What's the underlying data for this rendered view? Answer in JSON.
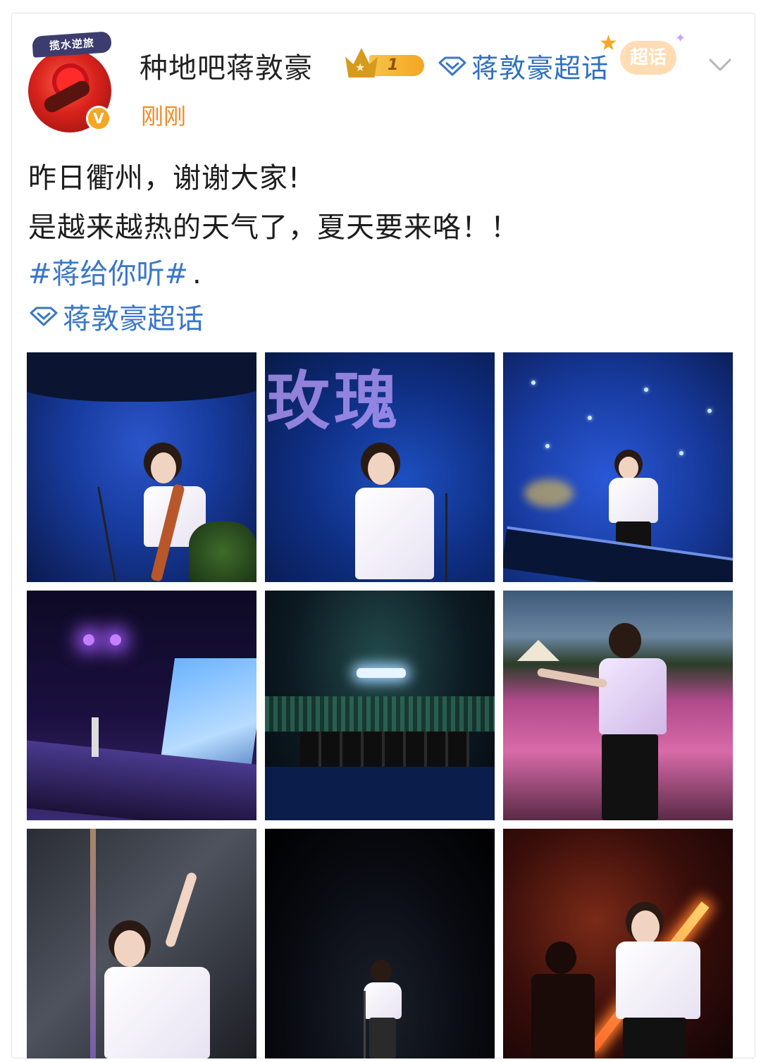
{
  "post": {
    "avatar_badge": "揽水逆旅",
    "username": "种地吧蒋敦豪",
    "level": "1",
    "supertopic_label": "蒋敦豪超话",
    "sticker_text": "超话",
    "timestamp": "刚刚",
    "line1": "昨日衢州，谢谢大家!",
    "line2": "是越来越热的天气了，夏天要来咯！！",
    "hashtag": "#蒋给你听#",
    "hashtag_suffix": ".",
    "topic_link": "蒋敦豪超话",
    "photo2_text": "玫瑰"
  },
  "colors": {
    "link_blue": "#3a77c8",
    "timestamp_orange": "#f38a25",
    "verified_gold": "#f5a623"
  },
  "icons": [
    "verified-v-icon",
    "crown-level-icon",
    "diamond-icon",
    "chevron-down-icon"
  ]
}
